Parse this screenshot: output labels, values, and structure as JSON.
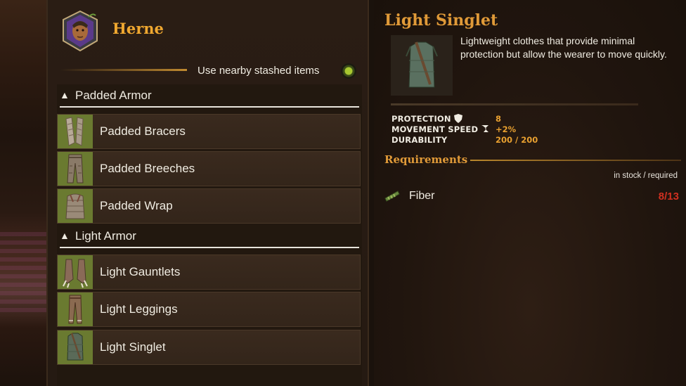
{
  "npc": {
    "name": "Herne",
    "avatar_icon": "npc-portrait-icon"
  },
  "stash": {
    "label": "Use nearby stashed items",
    "enabled": true
  },
  "categories": [
    {
      "label": "Padded Armor",
      "items": [
        {
          "label": "Padded Bracers",
          "icon": "bracers-icon"
        },
        {
          "label": "Padded Breeches",
          "icon": "breeches-icon"
        },
        {
          "label": "Padded Wrap",
          "icon": "wrap-icon"
        }
      ]
    },
    {
      "label": "Light Armor",
      "items": [
        {
          "label": "Light Gauntlets",
          "icon": "gauntlets-icon"
        },
        {
          "label": "Light Leggings",
          "icon": "leggings-icon"
        },
        {
          "label": "Light Singlet",
          "icon": "singlet-icon"
        }
      ]
    }
  ],
  "detail": {
    "title": "Light Singlet",
    "description": "Lightweight clothes that provide minimal protection but allow the wearer to move quickly.",
    "stats": [
      {
        "name": "PROTECTION",
        "icon": "shield-icon",
        "value": "8"
      },
      {
        "name": "MOVEMENT SPEED",
        "icon": "speed-icon",
        "value": "+2%"
      },
      {
        "name": "DURABILITY",
        "icon": "",
        "value": "200 / 200"
      }
    ],
    "requirements_title": "Requirements",
    "requirements_header": "in stock / required",
    "requirements": [
      {
        "name": "Fiber",
        "icon": "fiber-icon",
        "count": "8/13"
      }
    ]
  },
  "colors": {
    "accent": "#f0a830",
    "title": "#e09a38",
    "stat_value": "#e8a030",
    "insufficient": "#d03020",
    "thumb_bg": "#6a7a30"
  }
}
